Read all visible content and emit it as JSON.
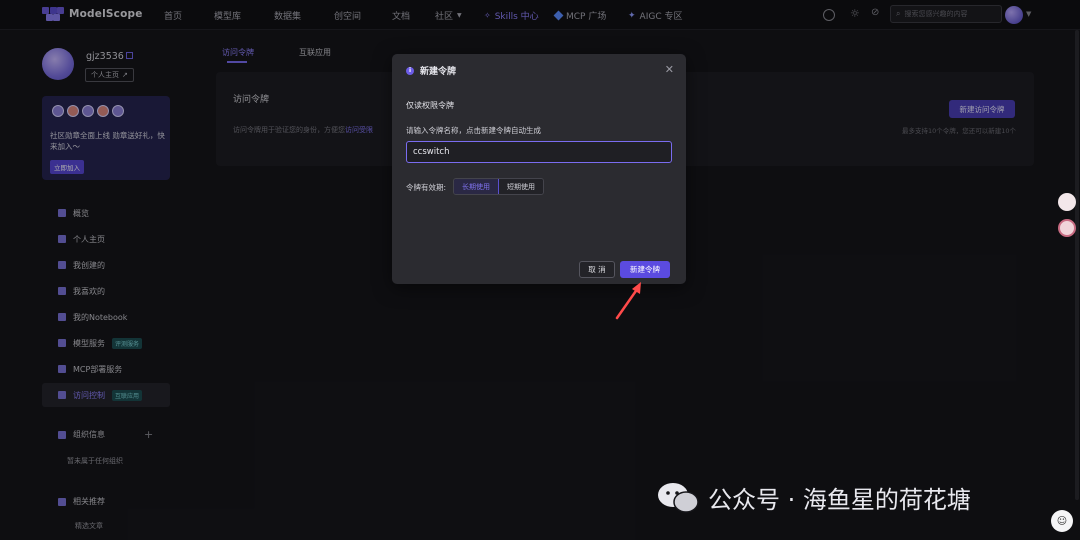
{
  "topbar": {
    "logo_text": "ModelScope",
    "nav": [
      {
        "label": "首页"
      },
      {
        "label": "模型库"
      },
      {
        "label": "数据集"
      },
      {
        "label": "创空间"
      },
      {
        "label": "文档"
      },
      {
        "label": "社区"
      },
      {
        "label": "Skills 中心"
      },
      {
        "label": "MCP 广场"
      },
      {
        "label": "AIGC 专区"
      }
    ],
    "search_placeholder": "搜索您感兴趣的内容"
  },
  "sidebar": {
    "username": "gjz3536",
    "homepage_btn": "个人主页",
    "promo_text": "社区勋章全面上线 勋章送好礼，快来加入～",
    "promo_join": "立即加入",
    "menu": [
      {
        "label": "概览",
        "tag": ""
      },
      {
        "label": "个人主页",
        "tag": ""
      },
      {
        "label": "我创建的",
        "tag": ""
      },
      {
        "label": "我喜欢的",
        "tag": ""
      },
      {
        "label": "我的Notebook",
        "tag": ""
      },
      {
        "label": "模型服务",
        "tag": "评测服务"
      },
      {
        "label": "MCP部署服务",
        "tag": ""
      },
      {
        "label": "访问控制",
        "tag": "互联应用"
      }
    ],
    "org_title": "组织信息",
    "org_empty": "暂未属于任何组织",
    "rec_title": "相关推荐",
    "rec_item": "精选文章"
  },
  "main": {
    "tabs": [
      {
        "label": "访问令牌"
      },
      {
        "label": "互联应用"
      }
    ],
    "card_title": "访问令牌",
    "card_desc": "访问令牌用于验证您的身份，方便您",
    "card_desc_link": "访问受限",
    "new_token_btn": "新建访问令牌",
    "card_note": "最多支持10个令牌，您还可以新建10个"
  },
  "modal": {
    "title": "新建令牌",
    "scope_label": "仅读权限令牌",
    "name_hint": "请输入令牌名称，点击新建令牌自动生成",
    "name_value": "ccswitch",
    "validity_label": "令牌有效期:",
    "validity_options": [
      {
        "label": "长期使用"
      },
      {
        "label": "短期使用"
      }
    ],
    "cancel": "取 消",
    "create": "新建令牌"
  },
  "watermark": {
    "text": "公众号 · 海鱼星的荷花塘"
  },
  "colors": {
    "accent": "#7a6cf0",
    "background": "#16161a",
    "primary_button": "#5b4be0"
  }
}
